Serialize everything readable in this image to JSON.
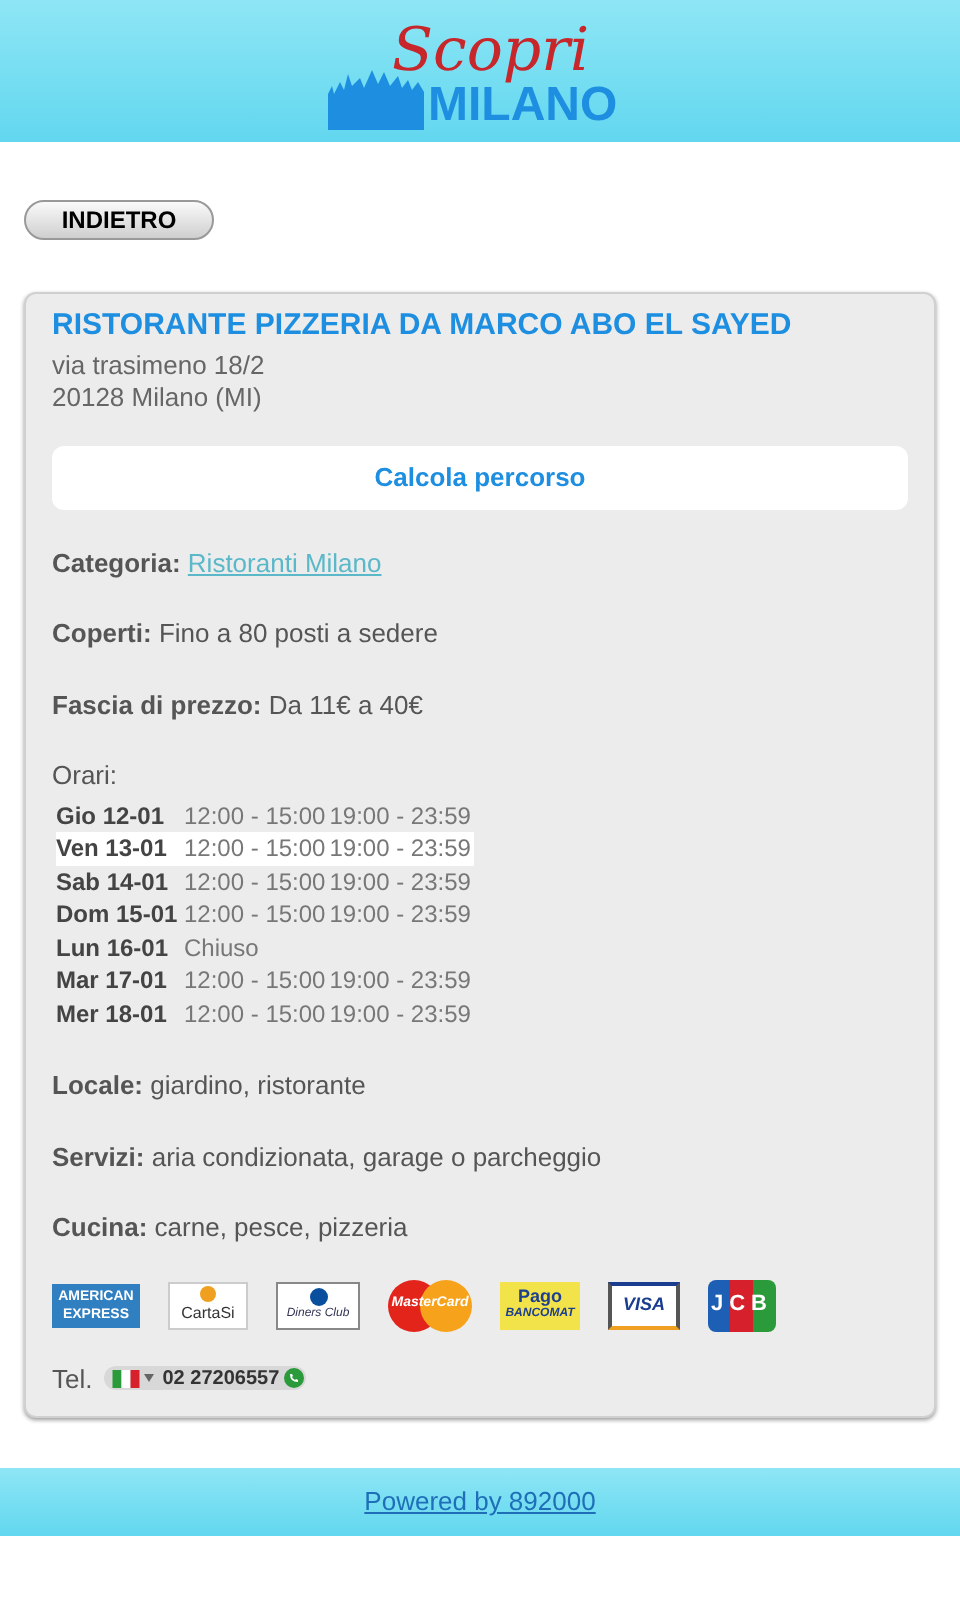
{
  "header": {
    "logo_script": "Scopri",
    "logo_word": "MILANO"
  },
  "back_button": "INDIETRO",
  "restaurant": {
    "name": "RISTORANTE PIZZERIA DA MARCO ABO EL SAYED",
    "address_lines": [
      "via trasimeno 18/2",
      "20128 Milano (MI)"
    ],
    "route_button": "Calcola percorso",
    "details_top": [
      {
        "label": "Categoria:",
        "value": "Ristoranti Milano",
        "kind": "link"
      },
      {
        "label": "Coperti:",
        "value": "Fino a 80 posti a sedere",
        "kind": "text"
      },
      {
        "label": "Fascia di prezzo:",
        "value": "Da 11€ a 40€",
        "kind": "text"
      }
    ],
    "hours_label": "Orari:",
    "hours": [
      {
        "day": "Gio 12-01",
        "slots": [
          "12:00 - 15:00",
          "19:00 - 23:59"
        ],
        "selected": false
      },
      {
        "day": "Ven 13-01",
        "slots": [
          "12:00 - 15:00",
          "19:00 - 23:59"
        ],
        "selected": true
      },
      {
        "day": "Sab 14-01",
        "slots": [
          "12:00 - 15:00",
          "19:00 - 23:59"
        ],
        "selected": false
      },
      {
        "day": "Dom 15-01",
        "slots": [
          "12:00 - 15:00",
          "19:00 - 23:59"
        ],
        "selected": false
      },
      {
        "day": "Lun 16-01",
        "slots": [
          "Chiuso"
        ],
        "selected": false
      },
      {
        "day": "Mar 17-01",
        "slots": [
          "12:00 - 15:00",
          "19:00 - 23:59"
        ],
        "selected": false
      },
      {
        "day": "Mer 18-01",
        "slots": [
          "12:00 - 15:00",
          "19:00 - 23:59"
        ],
        "selected": false
      }
    ],
    "details_bottom": [
      {
        "label": "Locale:",
        "value": "giardino, ristorante"
      },
      {
        "label": "Servizi:",
        "value": "aria condizionata, garage o parcheggio"
      },
      {
        "label": "Cucina:",
        "value": "carne, pesce, pizzeria"
      }
    ],
    "payments": [
      {
        "kind": "amex",
        "lines": [
          "AMERICAN",
          "EXPRESS"
        ]
      },
      {
        "kind": "cartasi",
        "lines": [
          "CartaSi"
        ]
      },
      {
        "kind": "diners",
        "lines": [
          "Diners Club"
        ]
      },
      {
        "kind": "mastercard",
        "lines": [
          "MasterCard"
        ]
      },
      {
        "kind": "bancomat",
        "lines": [
          "Pago",
          "BANCOMAT"
        ]
      },
      {
        "kind": "visa",
        "lines": [
          "VISA"
        ]
      },
      {
        "kind": "jcb",
        "lines": [
          "JCB"
        ]
      }
    ],
    "phone_label": "Tel.",
    "phone_number": "02 27206557"
  },
  "footer": {
    "link": "Powered by 892000"
  }
}
